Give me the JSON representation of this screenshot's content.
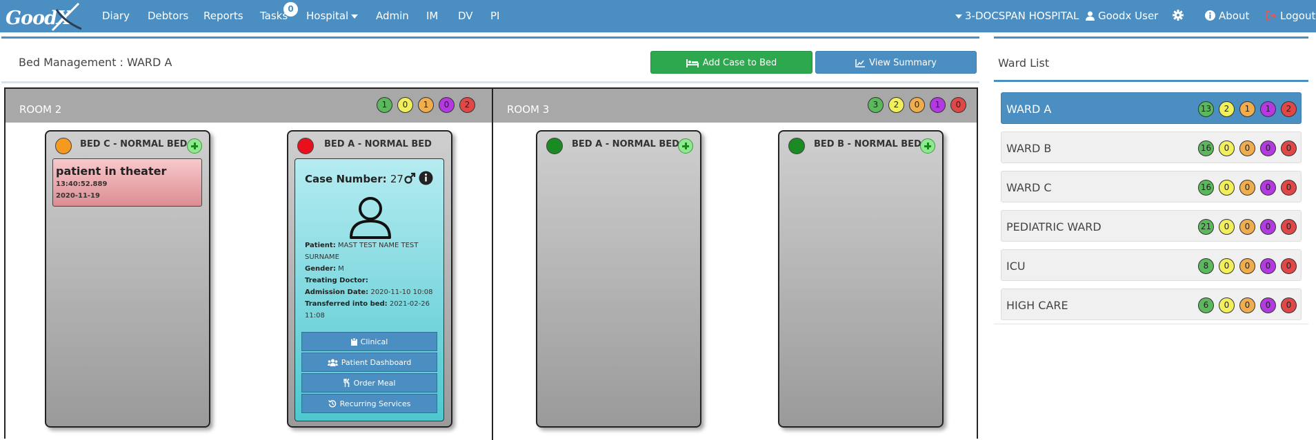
{
  "navbar": {
    "logo": "GoodX",
    "items": [
      "Diary",
      "Debtors",
      "Reports",
      "Tasks",
      "Hospital",
      "Admin",
      "IM",
      "DV",
      "PI"
    ],
    "tasks_badge": "0",
    "hospital": "3-DOCSPAN HOSPITAL",
    "user": "Goodx User",
    "about": "About",
    "logout": "Logout",
    "icons": [
      "caret-down-icon",
      "user-icon",
      "gear-icon",
      "info-circle-icon",
      "sign-out-icon"
    ]
  },
  "page": {
    "title": "Bed Management : WARD A",
    "add_case_label": "Add Case to Bed",
    "view_summary_label": "View Summary"
  },
  "status_colors": {
    "green": "#5cb85c",
    "yellow": "#f2ef5c",
    "orange": "#f0ad4e",
    "purple": "#b23ae0",
    "red": "#e04848"
  },
  "rooms": [
    {
      "name": "ROOM 2",
      "counts": [
        "1",
        "0",
        "1",
        "0",
        "2"
      ],
      "beds": [
        {
          "title": "BED C - NORMAL BED",
          "status": "orange",
          "note": {
            "title": "patient in theater",
            "time": "13:40:52.889",
            "date": "2020-11-19"
          }
        },
        {
          "title": "BED A - NORMAL BED",
          "status": "red",
          "case": {
            "label": "Case Number:",
            "number": "27",
            "patient_label": "Patient:",
            "patient": "MAST TEST NAME TEST SURNAME",
            "gender_label": "Gender:",
            "gender": "M",
            "doctor_label": "Treating Doctor:",
            "doctor": "",
            "admission_label": "Admission Date:",
            "admission": "2020-11-10 10:08",
            "transfer_label": "Transferred into bed:",
            "transfer": "2021-02-26 11:08",
            "buttons": [
              "Clinical",
              "Patient Dashboard",
              "Order Meal",
              "Recurring Services"
            ]
          }
        }
      ]
    },
    {
      "name": "ROOM 3",
      "counts": [
        "3",
        "2",
        "0",
        "1",
        "0"
      ],
      "beds": [
        {
          "title": "BED A - NORMAL BED",
          "status": "green"
        },
        {
          "title": "BED B - NORMAL BED",
          "status": "green"
        }
      ]
    }
  ],
  "ward_list": {
    "title": "Ward List",
    "wards": [
      {
        "name": "WARD A",
        "counts": [
          "13",
          "2",
          "1",
          "1",
          "2"
        ],
        "active": true
      },
      {
        "name": "WARD B",
        "counts": [
          "16",
          "0",
          "0",
          "0",
          "0"
        ]
      },
      {
        "name": "WARD C",
        "counts": [
          "16",
          "0",
          "0",
          "0",
          "0"
        ]
      },
      {
        "name": "PEDIATRIC WARD",
        "counts": [
          "21",
          "0",
          "0",
          "0",
          "0"
        ]
      },
      {
        "name": "ICU",
        "counts": [
          "8",
          "0",
          "0",
          "0",
          "0"
        ]
      },
      {
        "name": "HIGH CARE",
        "counts": [
          "6",
          "0",
          "0",
          "0",
          "0"
        ]
      }
    ]
  }
}
